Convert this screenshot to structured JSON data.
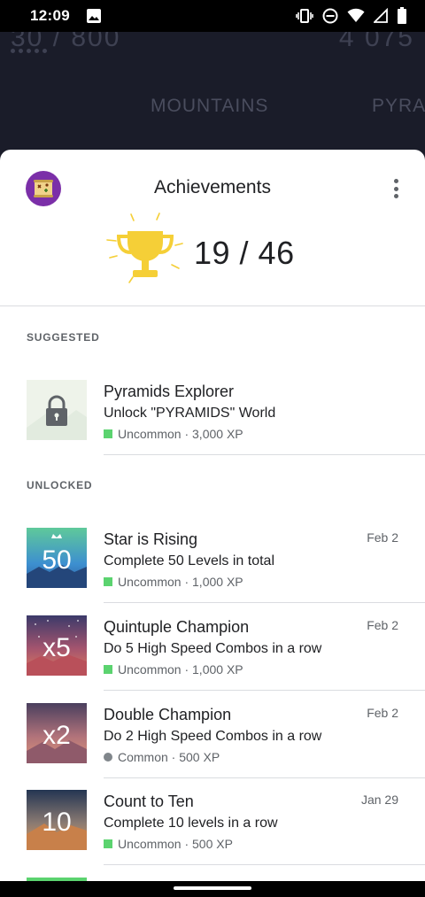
{
  "status_bar": {
    "time": "12:09"
  },
  "background": {
    "score_left": "30 / 800",
    "score_right": "4 075",
    "tab_center": "MOUNTAINS",
    "tab_right": "PYRA"
  },
  "sheet": {
    "title": "Achievements",
    "count": "19 / 46"
  },
  "suggested": {
    "label": "SUGGESTED",
    "item": {
      "name": "Pyramids Explorer",
      "desc": "Unlock \"PYRAMIDS\" World",
      "meta": "Uncommon · 3,000 XP",
      "rarity": "uncommon",
      "icon": "lock-icon"
    }
  },
  "unlocked": {
    "label": "UNLOCKED",
    "items": [
      {
        "name": "Star is Rising",
        "desc": "Complete 50 Levels in total",
        "meta": "Uncommon · 1,000 XP",
        "date": "Feb 2",
        "badge": "50",
        "rarity": "uncommon"
      },
      {
        "name": "Quintuple Champion",
        "desc": "Do 5 High Speed Combos in a row",
        "meta": "Uncommon · 1,000 XP",
        "date": "Feb 2",
        "badge": "x5",
        "rarity": "uncommon"
      },
      {
        "name": "Double Champion",
        "desc": "Do 2 High Speed Combos in a row",
        "meta": "Common · 500 XP",
        "date": "Feb 2",
        "badge": "x2",
        "rarity": "common"
      },
      {
        "name": "Count to Ten",
        "desc": "Complete 10 levels in a row",
        "meta": "Uncommon · 500 XP",
        "date": "Jan 29",
        "badge": "10",
        "rarity": "uncommon"
      }
    ]
  },
  "colors": {
    "uncommon": "#5bd36f",
    "common": "#80868b",
    "avatar_bg": "#7b2fa8",
    "trophy": "#f5cf37"
  }
}
